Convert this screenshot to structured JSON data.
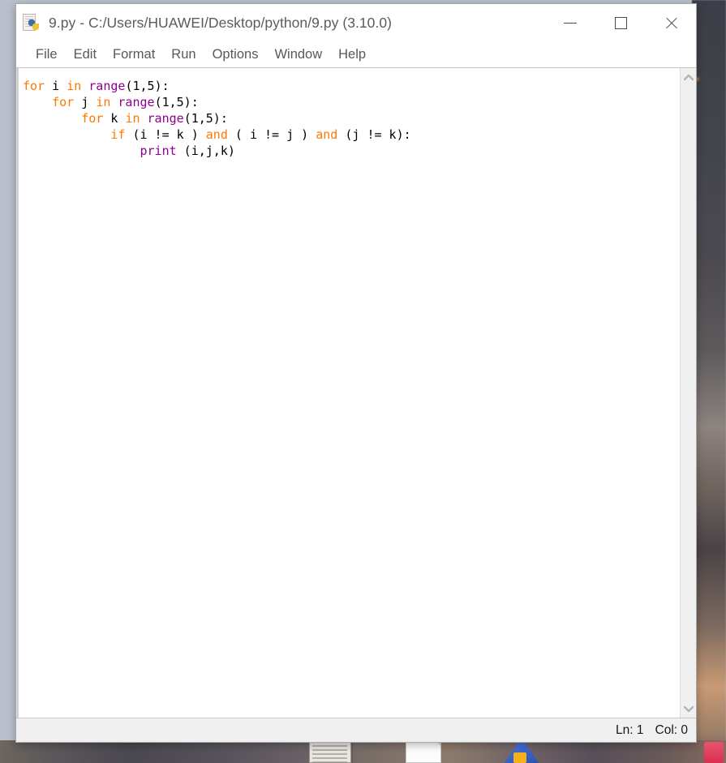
{
  "window": {
    "title": "9.py - C:/Users/HUAWEI/Desktop/python/9.py (3.10.0)",
    "icon": "python-file-icon",
    "controls": {
      "minimize": "minimize-icon",
      "maximize": "maximize-icon",
      "close": "close-icon"
    }
  },
  "menu": {
    "items": [
      {
        "label": "File"
      },
      {
        "label": "Edit"
      },
      {
        "label": "Format"
      },
      {
        "label": "Run"
      },
      {
        "label": "Options"
      },
      {
        "label": "Window"
      },
      {
        "label": "Help"
      }
    ]
  },
  "editor": {
    "lines": [
      [
        {
          "t": "for",
          "c": "keyword"
        },
        {
          "t": " i ",
          "c": "plain"
        },
        {
          "t": "in",
          "c": "keyword"
        },
        {
          "t": " ",
          "c": "plain"
        },
        {
          "t": "range",
          "c": "builtin"
        },
        {
          "t": "(1,5):",
          "c": "plain"
        }
      ],
      [
        {
          "t": "    ",
          "c": "plain"
        },
        {
          "t": "for",
          "c": "keyword"
        },
        {
          "t": " j ",
          "c": "plain"
        },
        {
          "t": "in",
          "c": "keyword"
        },
        {
          "t": " ",
          "c": "plain"
        },
        {
          "t": "range",
          "c": "builtin"
        },
        {
          "t": "(1,5):",
          "c": "plain"
        }
      ],
      [
        {
          "t": "        ",
          "c": "plain"
        },
        {
          "t": "for",
          "c": "keyword"
        },
        {
          "t": " k ",
          "c": "plain"
        },
        {
          "t": "in",
          "c": "keyword"
        },
        {
          "t": " ",
          "c": "plain"
        },
        {
          "t": "range",
          "c": "builtin"
        },
        {
          "t": "(1,5):",
          "c": "plain"
        }
      ],
      [
        {
          "t": "            ",
          "c": "plain"
        },
        {
          "t": "if",
          "c": "keyword"
        },
        {
          "t": " (i != k ) ",
          "c": "plain"
        },
        {
          "t": "and",
          "c": "keyword"
        },
        {
          "t": " ( i != j ) ",
          "c": "plain"
        },
        {
          "t": "and",
          "c": "keyword"
        },
        {
          "t": " (j != k):",
          "c": "plain"
        }
      ],
      [
        {
          "t": "                ",
          "c": "plain"
        },
        {
          "t": "print",
          "c": "builtin"
        },
        {
          "t": " (i,j,k)",
          "c": "plain"
        }
      ]
    ],
    "scrollbar": {
      "up_arrow": "chevron-up-icon",
      "down_arrow": "chevron-down-icon"
    }
  },
  "status": {
    "line": "Ln: 1",
    "column": "Col: 0"
  },
  "desktop": {
    "icons": [
      {
        "name": "notes-file-icon"
      },
      {
        "name": "document-file-icon"
      },
      {
        "name": "chrome-icon"
      },
      {
        "name": "pink-app-icon"
      }
    ]
  },
  "colors": {
    "keyword": "#ff7700",
    "builtin": "#900090",
    "plain": "#000000",
    "title_text": "#5b5b5b",
    "menu_text": "#585858",
    "status_bg": "#f0f0f0",
    "desktop_bg": "#b9c0cb"
  }
}
